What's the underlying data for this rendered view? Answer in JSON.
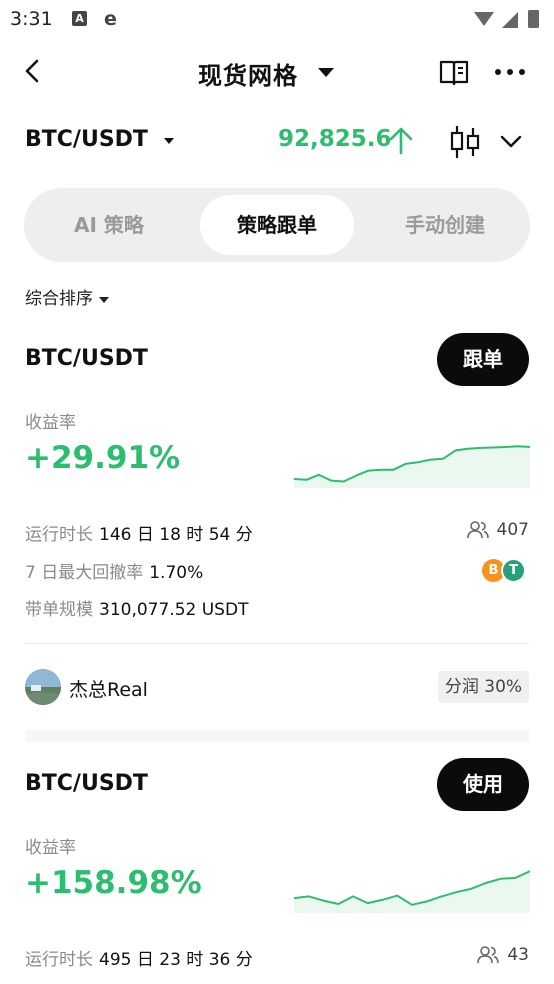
{
  "status": {
    "time": "3:31",
    "a_icon": "A",
    "e_icon": "e"
  },
  "nav": {
    "title": "现货网格",
    "icons": [
      "back-icon",
      "book-icon",
      "more-icon"
    ]
  },
  "pair": {
    "name": "BTC/USDT",
    "price": "92,825.6",
    "price_color": "#2dbd6e"
  },
  "tabs": [
    {
      "label": "AI 策略",
      "active": false
    },
    {
      "label": "策略跟单",
      "active": true
    },
    {
      "label": "手动创建",
      "active": false
    }
  ],
  "sort": {
    "label": "综合排序"
  },
  "cards": [
    {
      "pair": "BTC/USDT",
      "action": "跟单",
      "yield_label": "收益率",
      "yield": "+29.91%",
      "run_label": "运行时长",
      "run_value": "146 日 18 时 54 分",
      "drawdown_label": "7 日最大回撤率",
      "drawdown_value": "1.70%",
      "scale_label": "带单规模",
      "scale_value": "310,077.52 USDT",
      "followers": "407",
      "coins": [
        "B",
        "T"
      ],
      "leader": "杰总Real",
      "profit_share": "分润 30%",
      "spark": [
        0.12,
        0.1,
        0.22,
        0.08,
        0.06,
        0.2,
        0.32,
        0.34,
        0.34,
        0.48,
        0.52,
        0.58,
        0.6,
        0.8,
        0.84,
        0.86,
        0.87,
        0.88,
        0.9,
        0.88
      ]
    },
    {
      "pair": "BTC/USDT",
      "action": "使用",
      "yield_label": "收益率",
      "yield": "+158.98%",
      "run_label": "运行时长",
      "run_value": "495 日 23 时 36 分",
      "followers": "43",
      "spark": [
        0.26,
        0.3,
        0.2,
        0.12,
        0.3,
        0.14,
        0.22,
        0.32,
        0.1,
        0.18,
        0.3,
        0.4,
        0.48,
        0.62,
        0.72,
        0.74,
        0.9
      ]
    }
  ],
  "colors": {
    "green": "#2dbd6e",
    "btn": "#0b0b0b",
    "tab_bg": "#eeeeee"
  }
}
